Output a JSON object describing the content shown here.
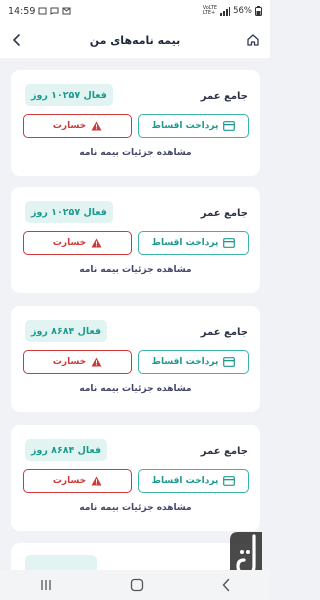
{
  "status_bar": {
    "time": "14:59",
    "network_line1": "VoLTE",
    "network_line2": "LTE+",
    "battery": "56%"
  },
  "app_bar": {
    "title": "بیمه نامه‌های من",
    "back_icon": "chevron-left-icon",
    "home_icon": "home-icon"
  },
  "policies": [
    {
      "name": "جامع عمر",
      "status": "فعال ۱۰۲۵۷ روز",
      "pay_label": "پرداخت اقساط",
      "loss_label": "خسارت",
      "details_label": "مشاهده جزئیات بیمه نامه"
    },
    {
      "name": "جامع عمر",
      "status": "فعال ۱۰۲۵۷ روز",
      "pay_label": "پرداخت اقساط",
      "loss_label": "خسارت",
      "details_label": "مشاهده جزئیات بیمه نامه"
    },
    {
      "name": "جامع عمر",
      "status": "فعال ۸۶۸۴ روز",
      "pay_label": "پرداخت اقساط",
      "loss_label": "خسارت",
      "details_label": "مشاهده جزئیات بیمه نامه"
    },
    {
      "name": "جامع عمر",
      "status": "فعال ۸۶۸۴ روز",
      "pay_label": "پرداخت اقساط",
      "loss_label": "خسارت",
      "details_label": "مشاهده جزئیات بیمه نامه"
    }
  ],
  "colors": {
    "accent": "#1d9a8e",
    "danger": "#cc3a3a",
    "badge_bg": "#e2f4f2",
    "background": "#f1f2f6"
  },
  "nav": {
    "recents_icon": "recents-icon",
    "home_icon": "nav-home-icon",
    "back_icon": "nav-back-icon"
  }
}
